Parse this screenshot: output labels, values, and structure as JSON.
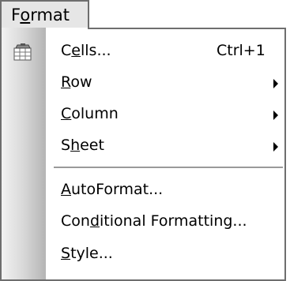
{
  "menubar": {
    "format": {
      "pre": "F",
      "underline": "o",
      "post": "rmat"
    }
  },
  "menu": {
    "items": [
      {
        "pre": "C",
        "underline": "e",
        "post": "lls...",
        "shortcut": "Ctrl+1"
      },
      {
        "pre": "",
        "underline": "R",
        "post": "ow"
      },
      {
        "pre": "",
        "underline": "C",
        "post": "olumn"
      },
      {
        "pre": "S",
        "underline": "h",
        "post": "eet"
      },
      {
        "pre": "",
        "underline": "A",
        "post": "utoFormat..."
      },
      {
        "pre": "Con",
        "underline": "d",
        "post": "itional Formatting..."
      },
      {
        "pre": "",
        "underline": "S",
        "post": "tyle..."
      }
    ],
    "icons": {
      "cells": "format-cells-icon",
      "submenu": "submenu-arrow-icon"
    }
  }
}
